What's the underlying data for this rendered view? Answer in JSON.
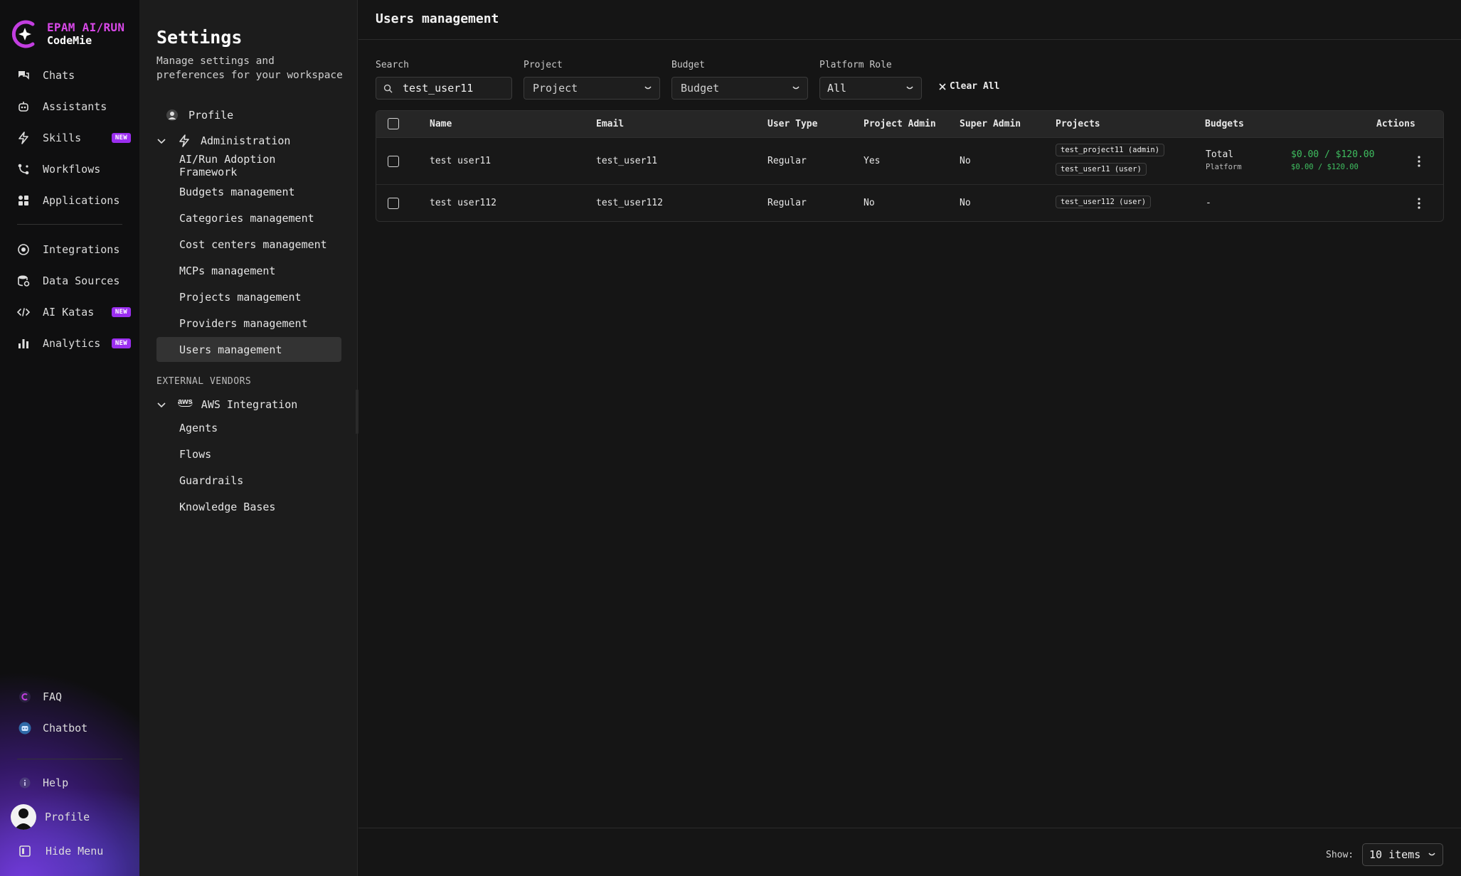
{
  "brand": {
    "line1": "EPAM AI/RUN",
    "line2": "CodeMie",
    "accent": "#d848e8"
  },
  "nav": {
    "items": [
      {
        "label": "Chats",
        "icon": "chats-icon"
      },
      {
        "label": "Assistants",
        "icon": "assistants-icon"
      },
      {
        "label": "Skills",
        "icon": "lightning-icon",
        "badge": "NEW"
      },
      {
        "label": "Workflows",
        "icon": "workflows-icon"
      },
      {
        "label": "Applications",
        "icon": "applications-icon"
      },
      {
        "label": "Integrations",
        "icon": "integrations-icon"
      },
      {
        "label": "Data Sources",
        "icon": "data-sources-icon"
      },
      {
        "label": "AI Katas",
        "icon": "code-icon",
        "badge": "NEW"
      },
      {
        "label": "Analytics",
        "icon": "bar-chart-icon",
        "badge": "NEW"
      }
    ],
    "bottom": [
      {
        "label": "FAQ",
        "icon": "faq-icon"
      },
      {
        "label": "Chatbot",
        "icon": "chatbot-icon"
      },
      {
        "label": "Help",
        "icon": "help-icon"
      },
      {
        "label": "Profile",
        "icon": "avatar"
      },
      {
        "label": "Hide Menu",
        "icon": "hide-menu-icon"
      }
    ],
    "badge_color": "#9b2ef0"
  },
  "settings": {
    "title": "Settings",
    "subtitle": "Manage settings and preferences for your workspace",
    "profile": "Profile",
    "administration": "Administration",
    "admin_items": [
      "AI/Run Adoption Framework",
      "Budgets management",
      "Categories management",
      "Cost centers management",
      "MCPs management",
      "Projects management",
      "Providers management",
      "Users management"
    ],
    "external_vendors": "EXTERNAL VENDORS",
    "aws_logo": "aws",
    "aws": "AWS Integration",
    "aws_items": [
      "Agents",
      "Flows",
      "Guardrails",
      "Knowledge Bases"
    ]
  },
  "main": {
    "title": "Users management",
    "filters": {
      "search_label": "Search",
      "search_value": "test_user11",
      "project_label": "Project",
      "project_value": "Project",
      "budget_label": "Budget",
      "budget_value": "Budget",
      "role_label": "Platform Role",
      "role_value": "All",
      "clear_all": "Clear All"
    },
    "columns": [
      "Name",
      "Email",
      "User Type",
      "Project Admin",
      "Super Admin",
      "Projects",
      "Budgets",
      "Actions"
    ],
    "rows": [
      {
        "name": "test user11",
        "email": "test_user11",
        "user_type": "Regular",
        "project_admin": "Yes",
        "super_admin": "No",
        "projects": [
          "test_project11 (admin)",
          "test_user11 (user)"
        ],
        "budget_total_label": "Total",
        "budget_total_value": "$0.00 / $120.00",
        "budget_platform_label": "Platform",
        "budget_platform_value": "$0.00 / $120.00"
      },
      {
        "name": "test user112",
        "email": "test_user112",
        "user_type": "Regular",
        "project_admin": "No",
        "super_admin": "No",
        "projects": [
          "test_user112 (user)"
        ],
        "budget_dash": "-"
      }
    ],
    "footer": {
      "show_label": "Show:",
      "page_size": "10 items"
    },
    "budget_color": "#3fbf60"
  }
}
